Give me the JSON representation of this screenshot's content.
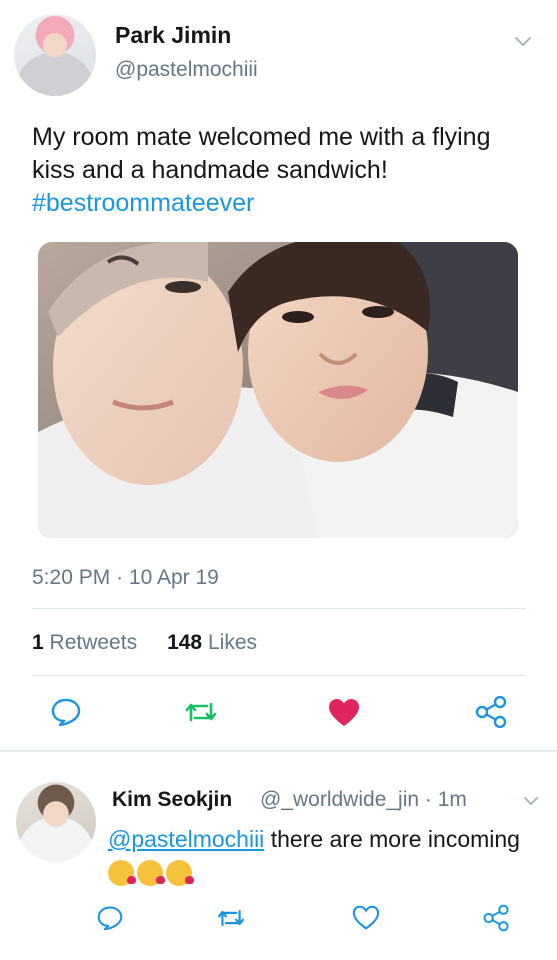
{
  "tweet": {
    "display_name": "Park Jimin",
    "handle": "@pastelmochiii",
    "text": "My room mate welcomed me with a flying kiss and a handmade sandwich!",
    "hashtag": "#bestroommateever",
    "time": "5:20 PM",
    "date_separator": "·",
    "date": "10 Apr 19",
    "retweets_count": "1",
    "retweets_label": "Retweets",
    "likes_count": "148",
    "likes_label": "Likes"
  },
  "reply": {
    "display_name": "Kim Seokjin",
    "handle": "@_worldwide_jin",
    "separator": "·",
    "age": "1m",
    "mention": "@pastelmochiii",
    "text": "there are more incoming",
    "emojis": [
      "face-blowing-kiss",
      "face-blowing-kiss",
      "face-blowing-kiss"
    ]
  },
  "icons": {
    "reply": "speech-bubble-icon",
    "retweet": "retweet-icon",
    "like_active": "heart-filled-icon",
    "like": "heart-outline-icon",
    "share": "share-icon",
    "caret": "chevron-down-icon"
  },
  "colors": {
    "accent": "#1b95e0",
    "retweet": "#17bf63",
    "like": "#e0245e",
    "secondary_text": "#657786",
    "divider": "#e1e8ed"
  }
}
